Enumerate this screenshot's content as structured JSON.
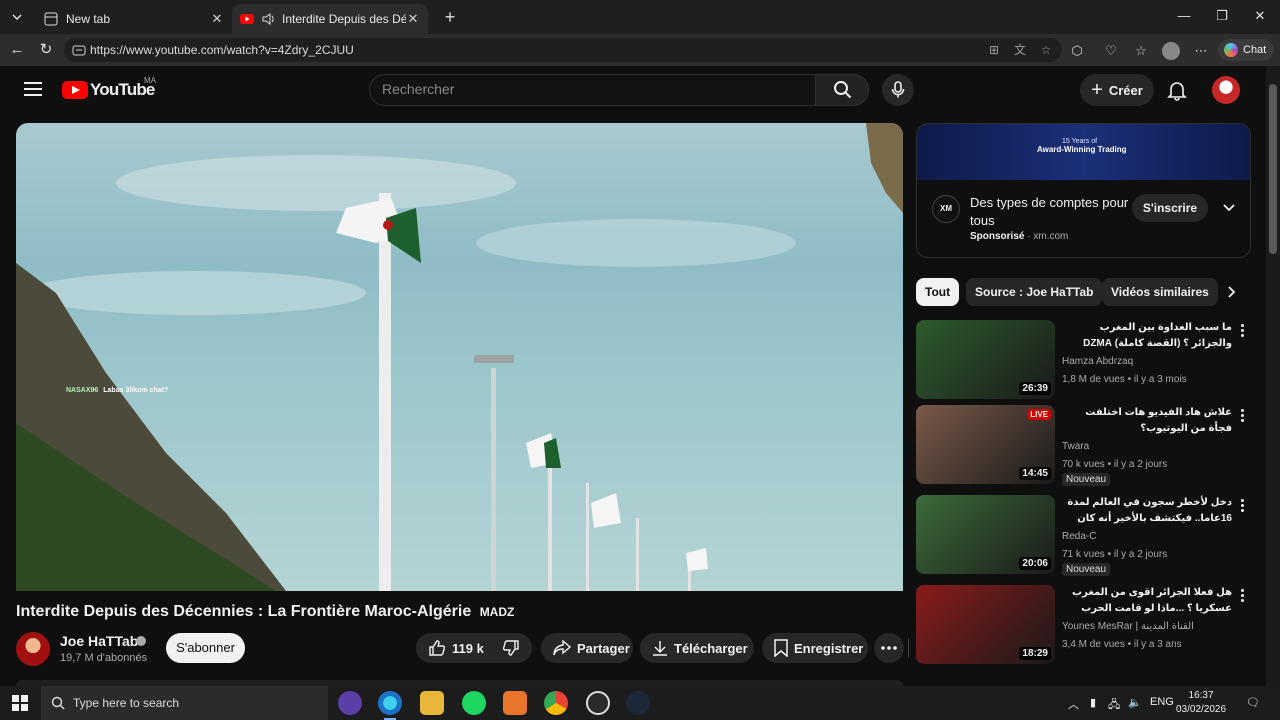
{
  "browser": {
    "tabs": [
      {
        "title": "New tab"
      },
      {
        "title": "Interdite Depuis des Décennies"
      }
    ],
    "url": "https://www.youtube.com/watch?v=4Zdry_2CJUU",
    "chat_label": "Chat"
  },
  "youtube": {
    "logo_text": "YouTube",
    "country_code": "MA",
    "search_placeholder": "Rechercher",
    "create_label": "Créer"
  },
  "player": {
    "chat_overlay_user": "NASAX96",
    "chat_overlay_message": "Labas 3likom chat?"
  },
  "video": {
    "title": "Interdite Depuis des Décennies : La Frontière Maroc-Algérie",
    "title_tag": "MADZ",
    "channel_name": "Joe HaTTab",
    "subscribers": "19,7 M d'abonnés",
    "subscribe_label": "S'abonner",
    "likes": "119 k",
    "share_label": "Partager",
    "download_label": "Télécharger",
    "save_label": "Enregistrer"
  },
  "ad": {
    "banner_line1": "15 Years of",
    "banner_line2": "Award-Winning Trading",
    "logo_text": "XM",
    "title": "Des types de comptes pour tous",
    "sponsored_label": "Sponsorisé",
    "domain": "xm.com",
    "cta_label": "S'inscrire"
  },
  "chips": [
    {
      "label": "Tout"
    },
    {
      "label": "Source : Joe HaTTab"
    },
    {
      "label": "Vidéos similaires"
    }
  ],
  "recommendations": [
    {
      "title": "ما سبب العداوة بين المغرب والجزائر ؟ (القصة كاملة) DZMA",
      "channel": "Hamza Abdrzaq",
      "meta": "1,8 M de vues • il y a 3 mois",
      "duration": "26:39",
      "badge": "",
      "live": "",
      "thumb_color": "#2e5b2e"
    },
    {
      "title": "علاش هاد الفيديو هات اختلفت فجأة من اليوتيوب؟",
      "channel": "Twara",
      "meta": "70 k vues • il y a 2 jours",
      "duration": "14:45",
      "badge": "Nouveau",
      "live": "LIVE",
      "thumb_color": "#7a5a4a"
    },
    {
      "title": "دخل لأخطر سجون في العالم لمدة 16عاما.. فيكتشف بالأخير أنه كان مظلوما",
      "channel": "Reda-C",
      "meta": "71 k vues • il y a 2 jours",
      "duration": "20:06",
      "badge": "Nouveau",
      "live": "",
      "thumb_color": "#3d6b3a"
    },
    {
      "title": "هل فعلا الجزائر اقوى من المغرب عسكريا ؟ ...ماذا لو قامت الحرب بين المغرب و الجزائر ؟",
      "channel": "Younes MesRar | القناة المدينة",
      "meta": "3,4 M de vues • il y a 3 ans",
      "duration": "18:29",
      "badge": "",
      "live": "",
      "thumb_color": "#8a1b1b"
    }
  ],
  "taskbar": {
    "search_placeholder": "Type here to search",
    "language": "ENG",
    "time": "16:37",
    "date": "03/02/2026"
  }
}
